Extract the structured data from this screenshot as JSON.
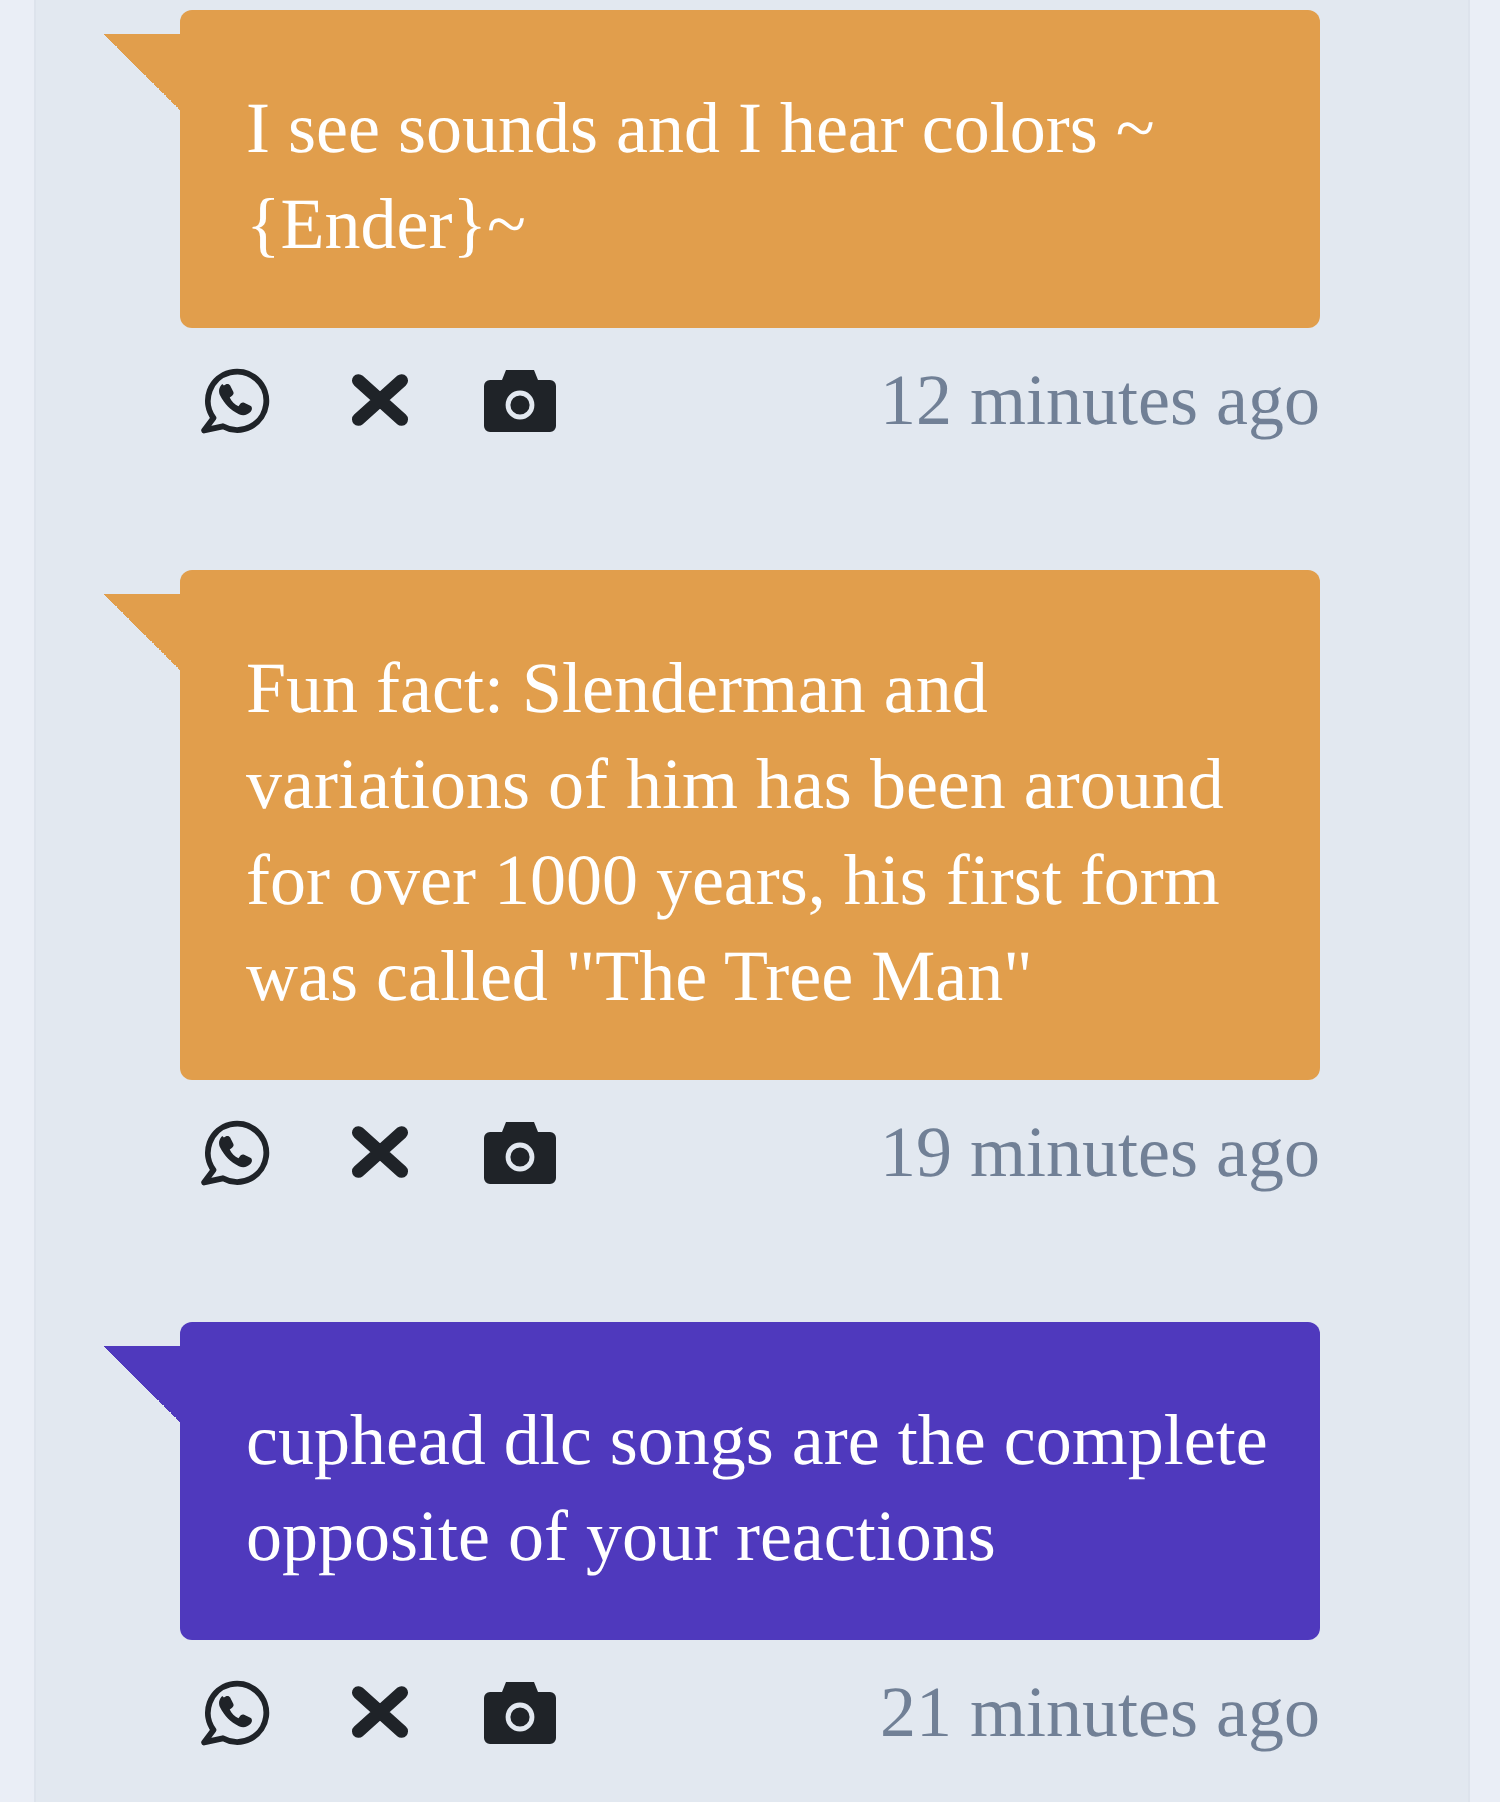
{
  "messages": [
    {
      "text": "I see sounds and I hear colors ~ {Ender}~",
      "color": "#e19e4c",
      "time": "12 minutes ago"
    },
    {
      "text": "Fun fact: Slenderman and variations of him has been around for over 1000 years, his first form was called \"The Tree Man\"",
      "color": "#e19e4c",
      "time": "19 minutes ago"
    },
    {
      "text": "cuphead dlc songs are the complete opposite of your reactions",
      "color": "#4f39bd",
      "time": "21 minutes ago"
    }
  ]
}
